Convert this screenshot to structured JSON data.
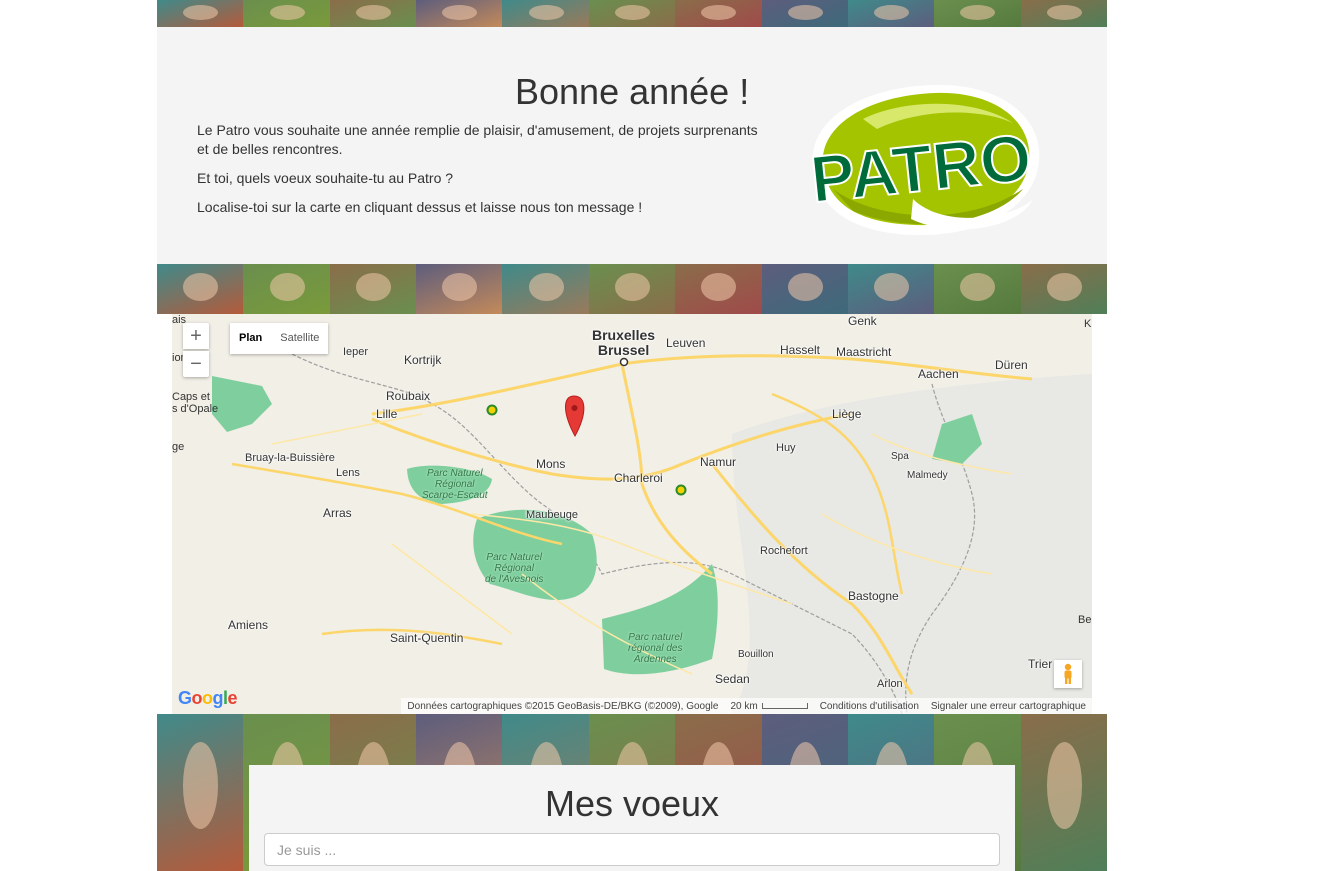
{
  "intro": {
    "title": "Bonne année !",
    "paragraphs": [
      "Le Patro vous souhaite une année remplie de plaisir, d'amusement, de projets surprenants et de belles rencontres.",
      "Et toi, quels voeux souhaite-tu au Patro ?",
      "Localise-toi sur la carte en cliquant dessus et laisse nous ton message !"
    ],
    "logo_text": "PATRO",
    "logo_icon": "patro-logo",
    "brand_green": "#006b3a",
    "brand_lime": "#a5c400"
  },
  "map": {
    "controls": {
      "zoom_in": "+",
      "zoom_out": "−",
      "type_plan": "Plan",
      "type_satellite": "Satellite",
      "active_type": "Plan"
    },
    "cities": {
      "bruxelles": "Bruxelles\nBrussel",
      "leuven": "Leuven",
      "hasselt": "Hasselt",
      "maastricht": "Maastricht",
      "genk": "Genk",
      "ieper": "Ieper",
      "kortrijk": "Kortrijk",
      "roubaix": "Roubaix",
      "lille": "Lille",
      "aachen": "Aachen",
      "duren": "Düren",
      "liege": "Liège",
      "huy": "Huy",
      "spa": "Spa",
      "malmedy": "Malmedy",
      "namur": "Namur",
      "charleroi": "Charleroi",
      "mons": "Mons",
      "maubeuge": "Maubeuge",
      "bruay": "Bruay-la-Buissière",
      "lens": "Lens",
      "arras": "Arras",
      "rochefort": "Rochefort",
      "bastogne": "Bastogne",
      "amiens": "Amiens",
      "saint_quentin": "Saint-Quentin",
      "bouillon": "Bouillon",
      "sedan": "Sedan",
      "arlon": "Arlon",
      "trier": "Trier"
    },
    "edge_labels": {
      "left1": "ais",
      "left2": "ional",
      "left3": "Caps et",
      "left4": "s d'Opale",
      "left5": "ge",
      "right1": "K",
      "right2": "Be"
    },
    "parks": {
      "scarpe": "Parc Naturel\nRégional\nScarpe-Escaut",
      "avesnois": "Parc Naturel\nRégional\nde l'Avesnois",
      "ardennes": "Parc naturel\nrégional des\nArdennes"
    },
    "attribution": {
      "logo": "Google",
      "data": "Données cartographiques ©2015 GeoBasis-DE/BKG (©2009), Google",
      "scale": "20 km",
      "terms": "Conditions d'utilisation",
      "report": "Signaler une erreur cartographique"
    },
    "marker_icon": "map-pin-icon",
    "marker_color": "#e53935",
    "dot_color": "#f5d000",
    "dot_ring": "#2a8a2a"
  },
  "voeux": {
    "title": "Mes voeux",
    "input_placeholder": "Je suis ...",
    "input_value": ""
  }
}
